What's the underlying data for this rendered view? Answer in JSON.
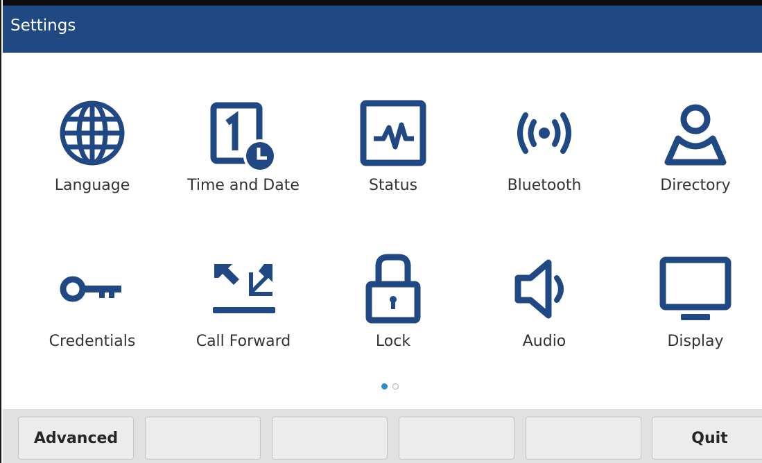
{
  "header": {
    "title": "Settings"
  },
  "tiles": [
    {
      "label": "Language",
      "icon": "globe-icon"
    },
    {
      "label": "Time and Date",
      "icon": "calendar-clock-icon"
    },
    {
      "label": "Status",
      "icon": "pulse-monitor-icon"
    },
    {
      "label": "Bluetooth",
      "icon": "bluetooth-waves-icon"
    },
    {
      "label": "Directory",
      "icon": "person-icon"
    },
    {
      "label": "Credentials",
      "icon": "key-icon"
    },
    {
      "label": "Call Forward",
      "icon": "call-forward-arrows-icon"
    },
    {
      "label": "Lock",
      "icon": "padlock-icon"
    },
    {
      "label": "Audio",
      "icon": "speaker-icon"
    },
    {
      "label": "Display",
      "icon": "monitor-icon"
    }
  ],
  "pagination": {
    "current_page": 1,
    "total_pages": 2
  },
  "softkeys": [
    "Advanced",
    "",
    "",
    "",
    "",
    "Quit"
  ],
  "colors": {
    "header_bg": "#204882",
    "icon": "#204882",
    "active_dot": "#2a8fd0",
    "softkey_bar": "#e1e1e1"
  }
}
